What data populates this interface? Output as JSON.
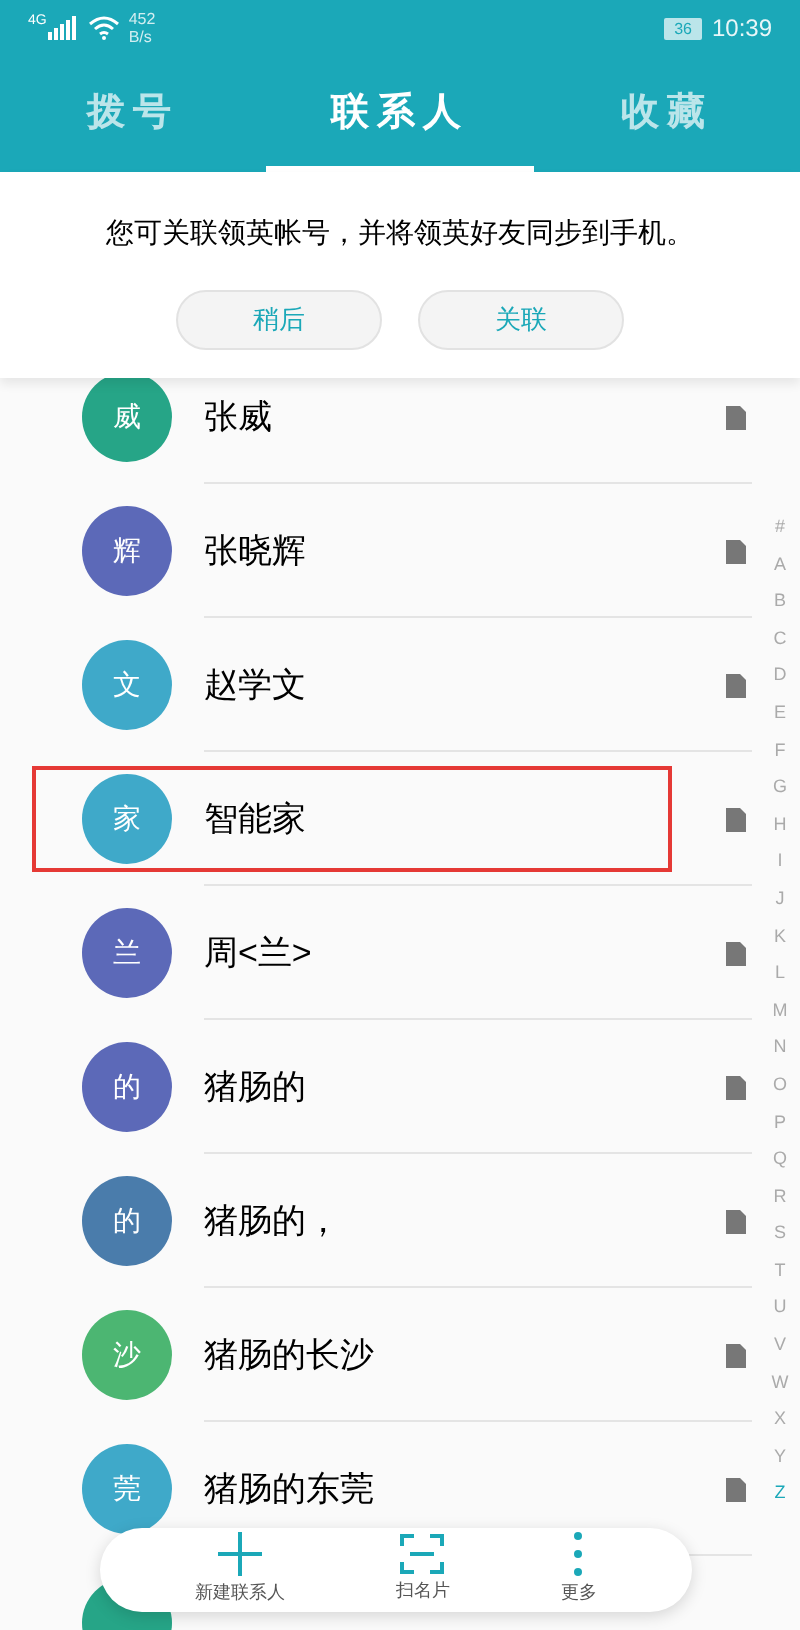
{
  "status_bar": {
    "network": "4G",
    "speed": "452",
    "speed_unit": "B/s",
    "battery": "36",
    "time": "10:39"
  },
  "tabs": [
    {
      "label": "拨号",
      "selected": false
    },
    {
      "label": "联系人",
      "selected": true
    },
    {
      "label": "收藏",
      "selected": false
    }
  ],
  "banner": {
    "message": "您可关联领英帐号，并将领英好友同步到手机。",
    "buttons": [
      "稍后",
      "关联"
    ]
  },
  "contacts": [
    {
      "initial": "威",
      "name": "张威",
      "color": "#26a587",
      "highlighted": false
    },
    {
      "initial": "辉",
      "name": "张晓辉",
      "color": "#5c69b8",
      "highlighted": false
    },
    {
      "initial": "文",
      "name": "赵学文",
      "color": "#3fa9c9",
      "highlighted": false
    },
    {
      "initial": "家",
      "name": "智能家",
      "color": "#3fa9c9",
      "highlighted": true
    },
    {
      "initial": "兰",
      "name": "周<兰>",
      "color": "#5c69b8",
      "highlighted": false
    },
    {
      "initial": "的",
      "name": "猪肠的",
      "color": "#5c69b8",
      "highlighted": false
    },
    {
      "initial": "的",
      "name": "猪肠的，",
      "color": "#4a7cab",
      "highlighted": false
    },
    {
      "initial": "沙",
      "name": "猪肠的长沙",
      "color": "#4cb672",
      "highlighted": false
    },
    {
      "initial": "莞",
      "name": "猪肠的东莞",
      "color": "#3fa9c9",
      "highlighted": false
    },
    {
      "color": "#26a587",
      "highlighted": false
    }
  ],
  "index_bar": [
    "#",
    "A",
    "B",
    "C",
    "D",
    "E",
    "F",
    "G",
    "H",
    "I",
    "J",
    "K",
    "L",
    "M",
    "N",
    "O",
    "P",
    "Q",
    "R",
    "S",
    "T",
    "U",
    "V",
    "W",
    "X",
    "Y",
    "Z"
  ],
  "toolbar": [
    {
      "kind": "add",
      "label": "新建联系人"
    },
    {
      "kind": "scan",
      "label": "扫名片"
    },
    {
      "kind": "more",
      "label": "更多"
    }
  ]
}
